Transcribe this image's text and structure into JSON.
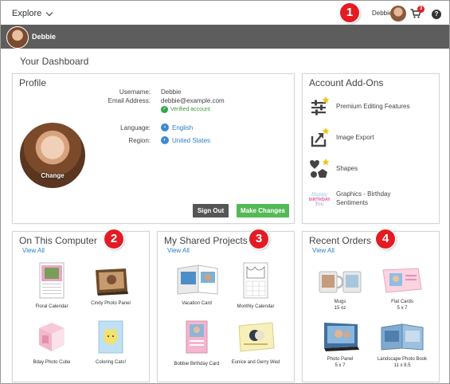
{
  "topbar": {
    "explore_label": "Explore",
    "user_name": "Debbie",
    "cart_count": "3",
    "help_label": "?"
  },
  "userbar": {
    "user_name": "Debbie"
  },
  "callouts": [
    "1",
    "2",
    "3",
    "4"
  ],
  "page_title": "Your Dashboard",
  "profile": {
    "title": "Profile",
    "change_label": "Change",
    "username_label": "Username:",
    "username": "Debbie",
    "email_label": "Email Address:",
    "email": "debbie@example.com",
    "verified_label": "Verified account",
    "language_label": "Language:",
    "language": "English",
    "region_label": "Region:",
    "region": "United States",
    "sign_out_label": "Sign Out",
    "make_changes_label": "Make Changes"
  },
  "addons": {
    "title": "Account Add-Ons",
    "items": [
      {
        "label": "Premium Editing Features",
        "icon": "sliders-star-icon"
      },
      {
        "label": "Image Export",
        "icon": "export-star-icon"
      },
      {
        "label": "Shapes",
        "icon": "shapes-star-icon"
      },
      {
        "label": "Graphics - Birthday Sentiments",
        "icon": "birthday-graphic-icon"
      }
    ]
  },
  "on_computer": {
    "title": "On This Computer",
    "view_all": "View All",
    "items": [
      {
        "label": "Floral Calendar"
      },
      {
        "label": "Cindy Photo Panel"
      },
      {
        "label": "Bday Photo Cube"
      },
      {
        "label": "Coloring Cats!"
      }
    ]
  },
  "shared": {
    "title": "My Shared Projects",
    "view_all": "View All",
    "items": [
      {
        "label": "Vacation Card"
      },
      {
        "label": "Monthly Calendar"
      },
      {
        "label": "Bobbie Birthday Card"
      },
      {
        "label": "Eunice and Gerry Wed"
      }
    ]
  },
  "orders": {
    "title": "Recent Orders",
    "view_all": "View All",
    "items": [
      {
        "label": "Mugs",
        "sub": "15 oz"
      },
      {
        "label": "Flat Cards",
        "sub": "5 x 7"
      },
      {
        "label": "Photo Panel",
        "sub": "5 x 7"
      },
      {
        "label": "Landscape Photo Book",
        "sub": "11 x 8.5"
      }
    ]
  },
  "colors": {
    "accent_link": "#2a7fc8",
    "callout_red": "#e31c23",
    "user_bar": "#5d5d5d",
    "make_changes_green": "#54b954",
    "sign_out_gray": "#555555"
  }
}
